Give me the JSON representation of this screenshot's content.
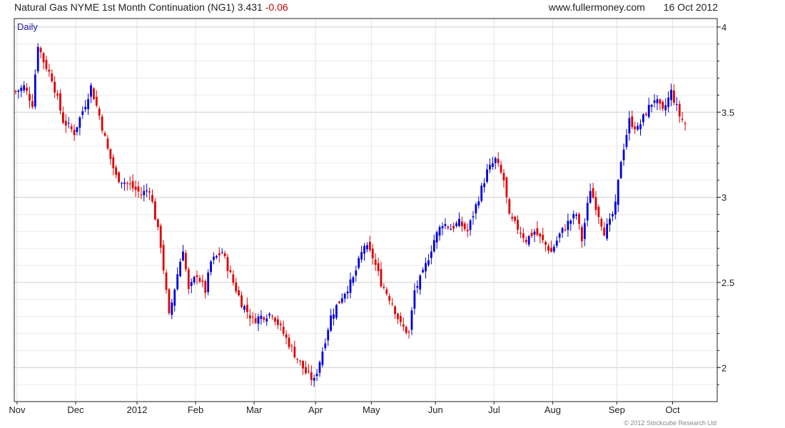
{
  "header": {
    "title": "Natural Gas NYME 1st Month Continuation (NG1)",
    "last": "3.431",
    "change": "-0.06",
    "site": "www.fullermoney.com",
    "date": "16 Oct 2012"
  },
  "colors": {
    "up": "#0000dd",
    "down": "#dd0000",
    "grid": "#cccccc",
    "axis": "#222222"
  },
  "copyright": "© 2012 Stockcube Research Ltd",
  "chart_data": {
    "type": "candlestick",
    "period_label": "Daily",
    "ylim": [
      1.8,
      4.05
    ],
    "y_ticks": [
      2,
      2.5,
      3,
      3.5,
      4
    ],
    "y_tick_labels": [
      "2",
      "2.5",
      "3",
      "3.5",
      "4"
    ],
    "month_labels": [
      "Nov",
      "Dec",
      "2012",
      "Feb",
      "Mar",
      "Apr",
      "May",
      "Jun",
      "Jul",
      "Aug",
      "Sep",
      "Oct"
    ],
    "month_positions": [
      1,
      22,
      44,
      65,
      86,
      108,
      128,
      151,
      172,
      193,
      216,
      236
    ],
    "total_bars": 252,
    "close_anchors": [
      [
        0,
        3.62
      ],
      [
        3,
        3.65
      ],
      [
        6,
        3.55
      ],
      [
        8,
        3.9
      ],
      [
        10,
        3.8
      ],
      [
        13,
        3.7
      ],
      [
        17,
        3.45
      ],
      [
        21,
        3.38
      ],
      [
        25,
        3.55
      ],
      [
        27,
        3.65
      ],
      [
        30,
        3.48
      ],
      [
        33,
        3.28
      ],
      [
        36,
        3.12
      ],
      [
        40,
        3.08
      ],
      [
        45,
        3.02
      ],
      [
        48,
        3.05
      ],
      [
        52,
        2.72
      ],
      [
        55,
        2.3
      ],
      [
        58,
        2.55
      ],
      [
        60,
        2.7
      ],
      [
        62,
        2.45
      ],
      [
        65,
        2.55
      ],
      [
        68,
        2.45
      ],
      [
        70,
        2.62
      ],
      [
        74,
        2.68
      ],
      [
        78,
        2.5
      ],
      [
        81,
        2.38
      ],
      [
        85,
        2.28
      ],
      [
        88,
        2.3
      ],
      [
        92,
        2.32
      ],
      [
        96,
        2.2
      ],
      [
        100,
        2.08
      ],
      [
        104,
        1.97
      ],
      [
        107,
        1.92
      ],
      [
        110,
        2.1
      ],
      [
        113,
        2.3
      ],
      [
        117,
        2.42
      ],
      [
        121,
        2.52
      ],
      [
        125,
        2.72
      ],
      [
        128,
        2.65
      ],
      [
        131,
        2.5
      ],
      [
        135,
        2.38
      ],
      [
        138,
        2.25
      ],
      [
        141,
        2.2
      ],
      [
        143,
        2.45
      ],
      [
        146,
        2.55
      ],
      [
        150,
        2.75
      ],
      [
        153,
        2.85
      ],
      [
        156,
        2.82
      ],
      [
        159,
        2.85
      ],
      [
        162,
        2.8
      ],
      [
        166,
        3.0
      ],
      [
        169,
        3.15
      ],
      [
        172,
        3.22
      ],
      [
        175,
        3.1
      ],
      [
        177,
        2.88
      ],
      [
        180,
        2.82
      ],
      [
        183,
        2.75
      ],
      [
        186,
        2.8
      ],
      [
        189,
        2.74
      ],
      [
        192,
        2.68
      ],
      [
        195,
        2.78
      ],
      [
        198,
        2.85
      ],
      [
        201,
        2.9
      ],
      [
        203,
        2.75
      ],
      [
        206,
        3.05
      ],
      [
        209,
        2.9
      ],
      [
        211,
        2.8
      ],
      [
        213,
        2.85
      ],
      [
        215,
        2.95
      ],
      [
        217,
        3.22
      ],
      [
        220,
        3.45
      ],
      [
        223,
        3.4
      ],
      [
        226,
        3.5
      ],
      [
        229,
        3.58
      ],
      [
        232,
        3.5
      ],
      [
        235,
        3.62
      ],
      [
        238,
        3.48
      ],
      [
        240,
        3.43
      ]
    ],
    "last_value": 3.431
  }
}
